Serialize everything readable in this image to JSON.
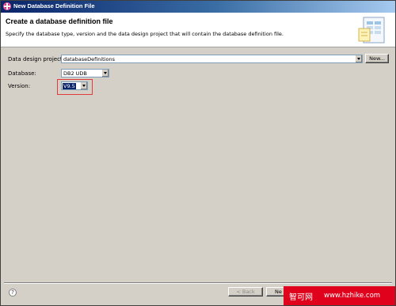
{
  "window": {
    "title": "New Database Definition File"
  },
  "banner": {
    "title": "Create a database definition file",
    "description": "Specify the database type, version and the data design project that will contain the database definition file."
  },
  "form": {
    "project_label": "Data design project:",
    "project_value": "databaseDefinitions",
    "new_button": "New...",
    "database_label": "Database:",
    "database_value": "DB2 UDB",
    "version_label": "Version:",
    "version_value": "V9.5"
  },
  "footer": {
    "help_glyph": "?",
    "back_button": "< Back",
    "next_button": "Ne"
  },
  "watermark": {
    "text_cn": "智可网",
    "text_url": "www.hzhike.com"
  }
}
